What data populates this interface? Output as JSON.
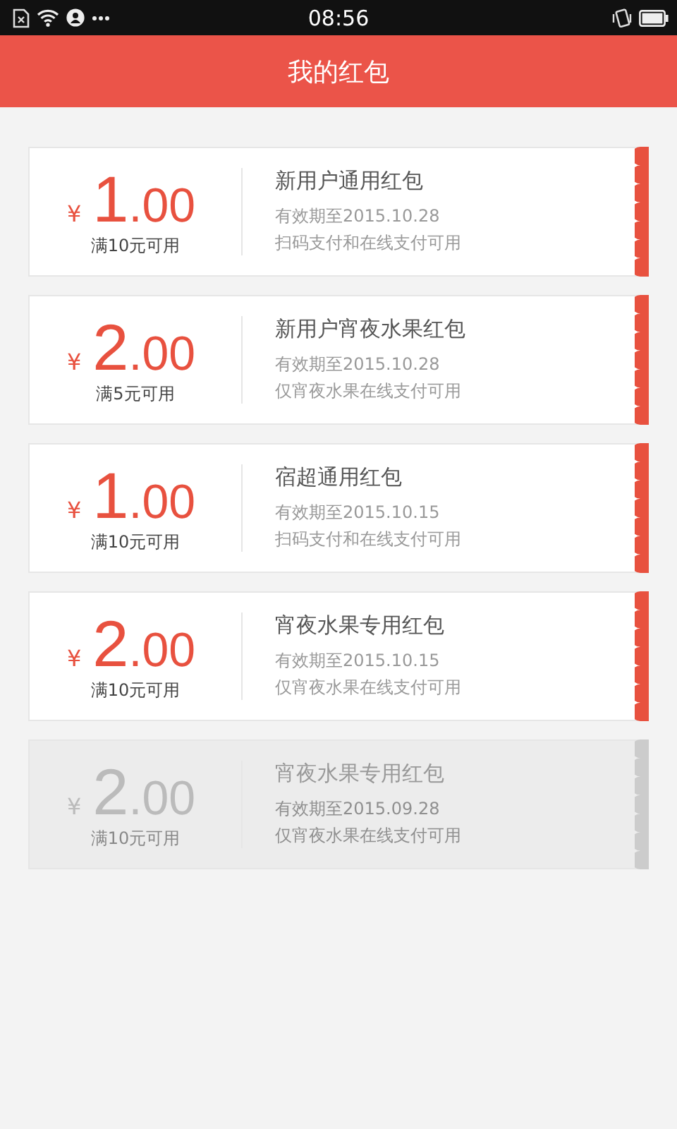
{
  "status_bar": {
    "time": "08:56"
  },
  "header": {
    "title": "我的红包"
  },
  "coupons": [
    {
      "currency": "¥",
      "amount_integer": "1",
      "amount_decimal": ".00",
      "condition": "满10元可用",
      "name": "新用户通用红包",
      "validity": "有效期至2015.10.28",
      "scope": "扫码支付和在线支付可用",
      "expired": false
    },
    {
      "currency": "¥",
      "amount_integer": "2",
      "amount_decimal": ".00",
      "condition": "满5元可用",
      "name": "新用户宵夜水果红包",
      "validity": "有效期至2015.10.28",
      "scope": "仅宵夜水果在线支付可用",
      "expired": false
    },
    {
      "currency": "¥",
      "amount_integer": "1",
      "amount_decimal": ".00",
      "condition": "满10元可用",
      "name": "宿超通用红包",
      "validity": "有效期至2015.10.15",
      "scope": "扫码支付和在线支付可用",
      "expired": false
    },
    {
      "currency": "¥",
      "amount_integer": "2",
      "amount_decimal": ".00",
      "condition": "满10元可用",
      "name": "宵夜水果专用红包",
      "validity": "有效期至2015.10.15",
      "scope": "仅宵夜水果在线支付可用",
      "expired": false
    },
    {
      "currency": "¥",
      "amount_integer": "2",
      "amount_decimal": ".00",
      "condition": "满10元可用",
      "name": "宵夜水果专用红包",
      "validity": "有效期至2015.09.28",
      "scope": "仅宵夜水果在线支付可用",
      "expired": true
    }
  ]
}
